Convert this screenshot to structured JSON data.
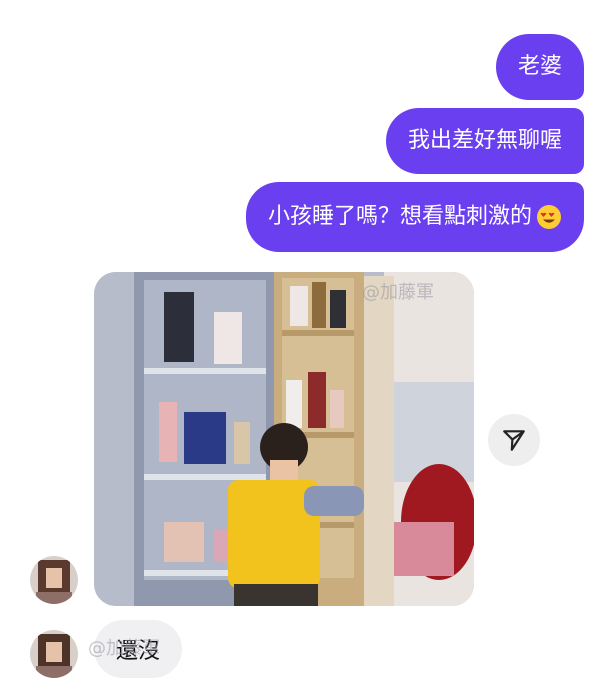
{
  "messages": {
    "sent": [
      {
        "text": "老婆"
      },
      {
        "text": "我出差好無聊喔"
      },
      {
        "text": "小孩睡了嗎？想看點刺激的"
      }
    ],
    "received_reply": {
      "text": "還沒"
    }
  },
  "watermarks": {
    "photo": "@加藤軍",
    "reply": "@加藤軍"
  },
  "icons": {
    "share": "paper-plane-icon",
    "emoji": "heart-eyes-emoji-icon"
  },
  "colors": {
    "sent_bubble": "#6a3ff0",
    "received_bubble": "#f0f0f2",
    "share_button_bg": "#eeeeee"
  }
}
